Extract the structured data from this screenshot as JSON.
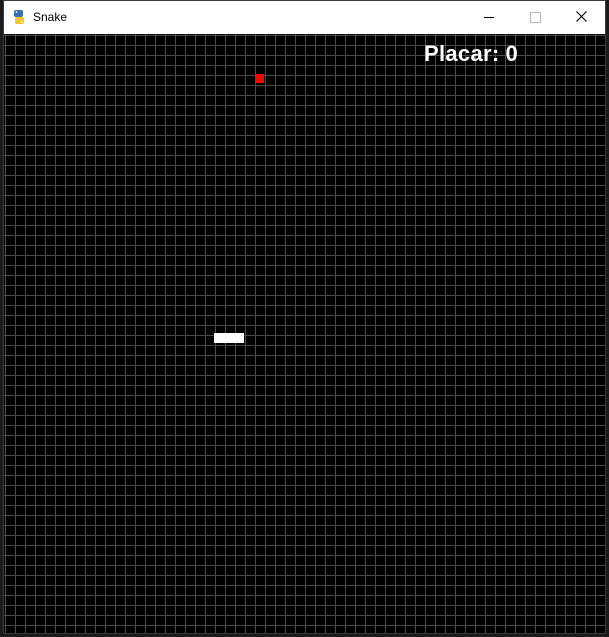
{
  "window": {
    "title": "Snake",
    "app_icon": "python-icon",
    "controls": [
      "minimize-icon",
      "maximize-icon",
      "close-icon"
    ]
  },
  "game": {
    "score_label": "Placar:",
    "score_value": "0",
    "colors": {
      "background": "#000000",
      "grid": "#4a4a4a",
      "snake": "#ffffff",
      "food": "#ff0000"
    }
  }
}
